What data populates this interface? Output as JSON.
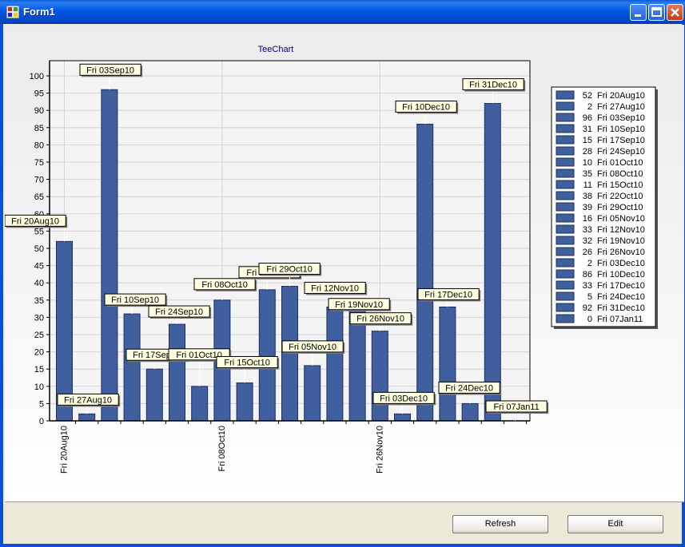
{
  "window": {
    "title": "Form1"
  },
  "buttons": {
    "refresh_label": "Refresh",
    "edit_label": "Edit"
  },
  "colors": {
    "bar": "#3f5f9f",
    "bar_edge": "#1f2f5f",
    "label_bg": "#ffffe1",
    "title": "#000080"
  },
  "chart_data": {
    "type": "bar",
    "title": "TeeChart",
    "xlabel": "",
    "ylabel": "",
    "ylim": [
      0,
      100
    ],
    "yticks": [
      0,
      5,
      10,
      15,
      20,
      25,
      30,
      35,
      40,
      45,
      50,
      55,
      60,
      65,
      70,
      75,
      80,
      85,
      90,
      95,
      100
    ],
    "xtick_labels": [
      "Fri 20Aug10",
      "Fri 08Oct10",
      "Fri 26Nov10"
    ],
    "grid": true,
    "legend_position": "right",
    "categories": [
      "Fri 20Aug10",
      "Fri 27Aug10",
      "Fri 03Sep10",
      "Fri 10Sep10",
      "Fri 17Sep10",
      "Fri 24Sep10",
      "Fri 01Oct10",
      "Fri 08Oct10",
      "Fri 15Oct10",
      "Fri 22Oct10",
      "Fri 29Oct10",
      "Fri 05Nov10",
      "Fri 12Nov10",
      "Fri 19Nov10",
      "Fri 26Nov10",
      "Fri 03Dec10",
      "Fri 10Dec10",
      "Fri 17Dec10",
      "Fri 24Dec10",
      "Fri 31Dec10",
      "Fri 07Jan11"
    ],
    "values": [
      52,
      2,
      96,
      31,
      15,
      28,
      10,
      35,
      11,
      38,
      39,
      16,
      33,
      32,
      26,
      2,
      86,
      33,
      5,
      92,
      0
    ]
  }
}
